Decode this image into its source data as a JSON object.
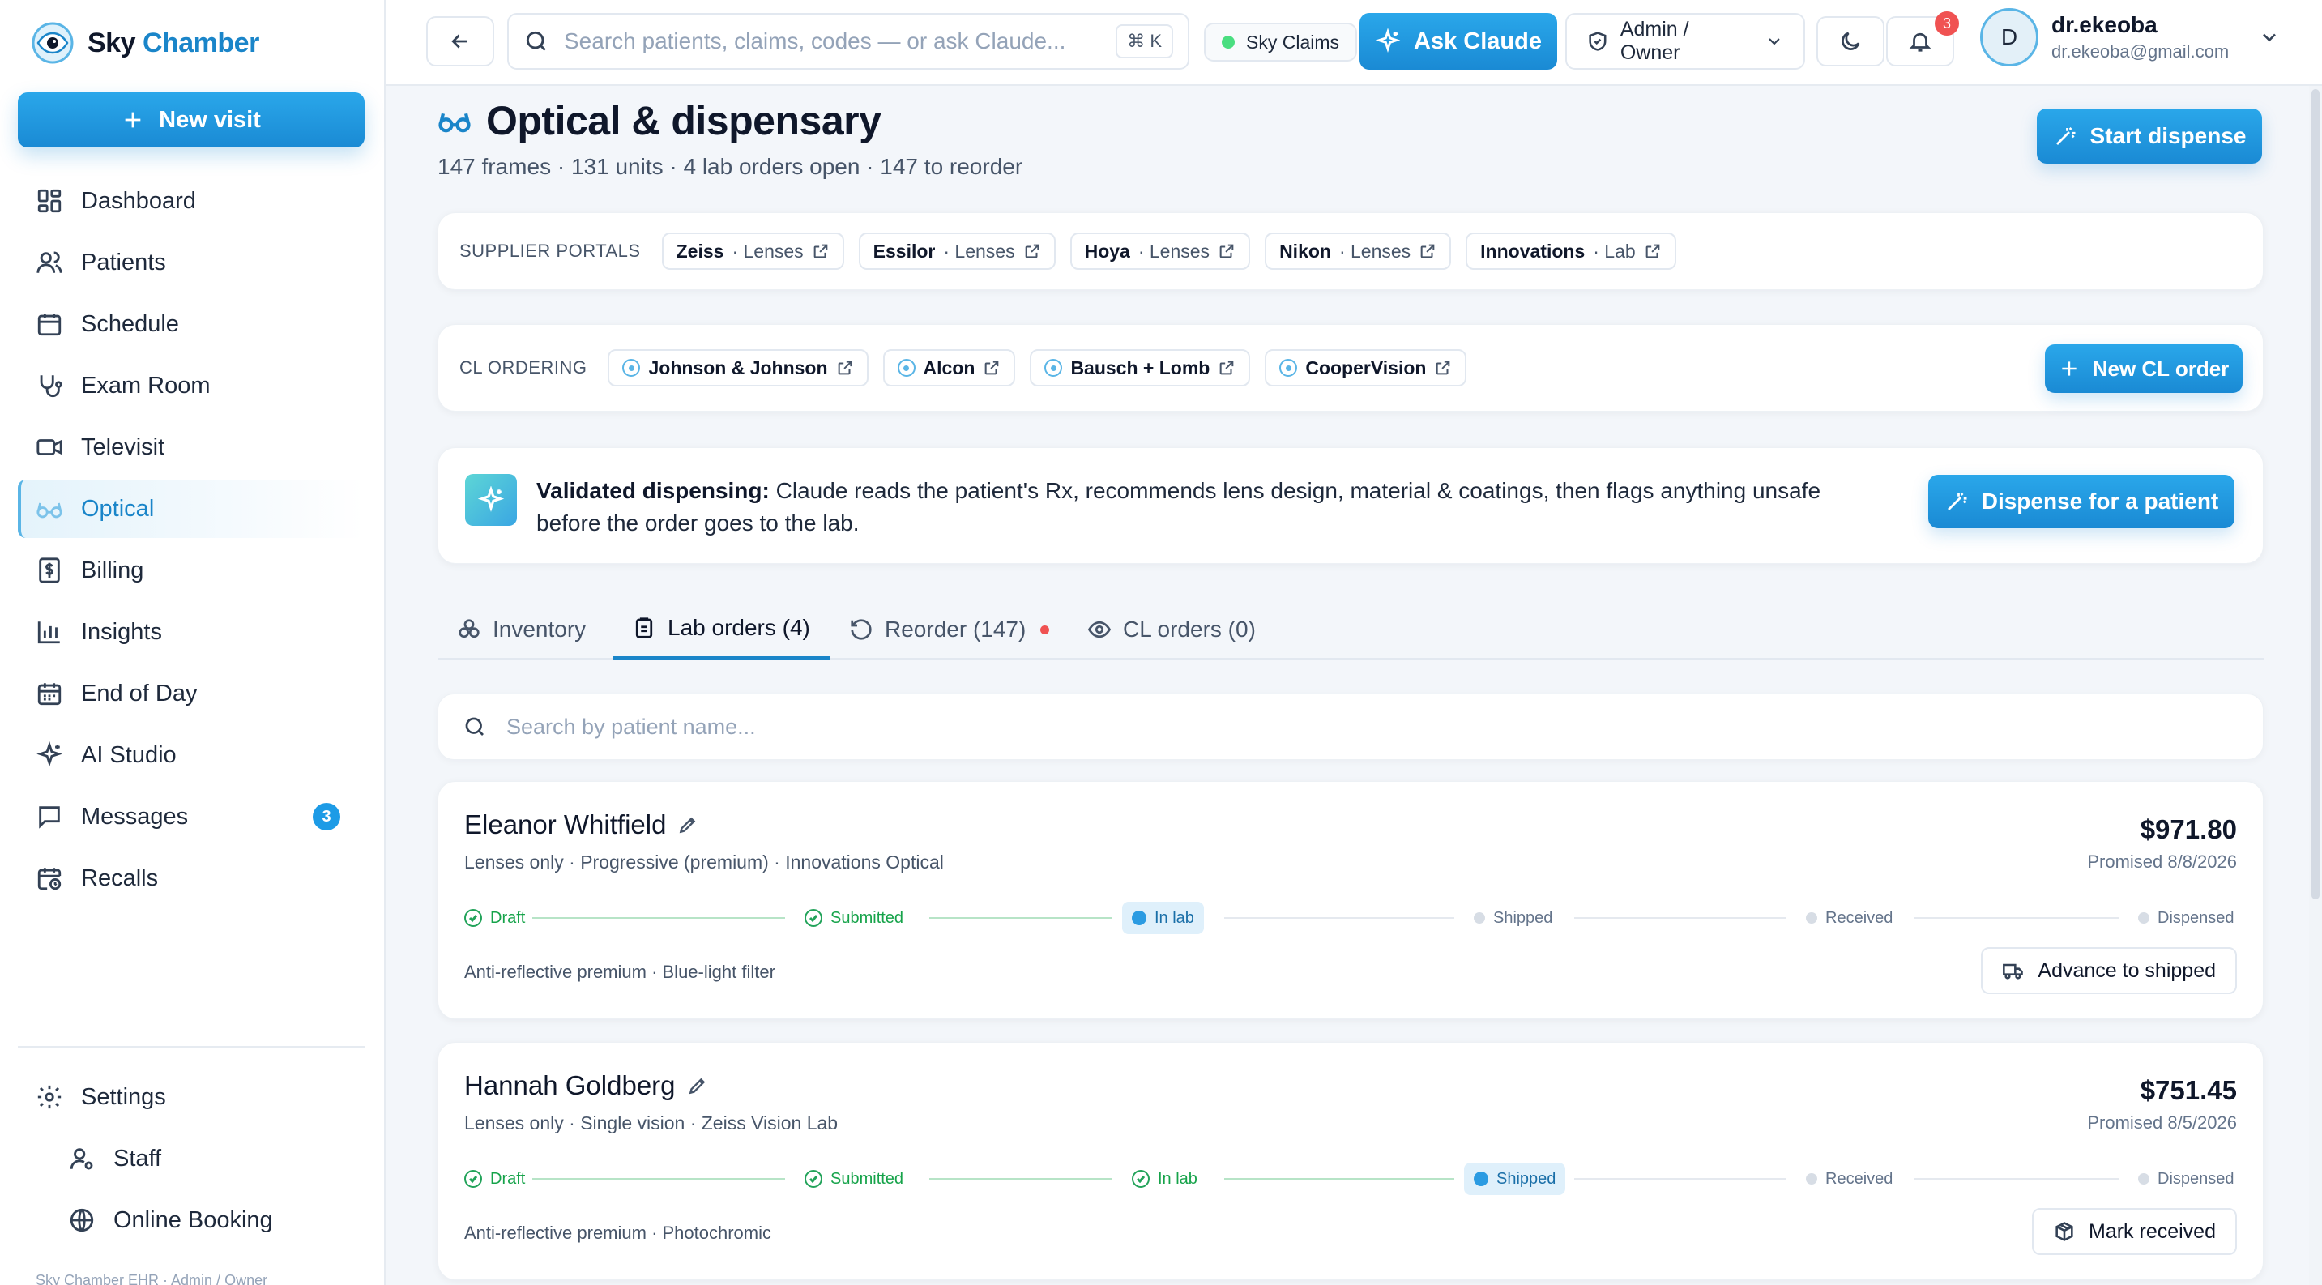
{
  "brand": {
    "name_main": "Sky",
    "name_accent": "Chamber"
  },
  "sidebar": {
    "new_visit": "New visit",
    "items": [
      {
        "label": "Dashboard",
        "icon": "dashboard-icon"
      },
      {
        "label": "Patients",
        "icon": "users-icon"
      },
      {
        "label": "Schedule",
        "icon": "calendar-icon"
      },
      {
        "label": "Exam Room",
        "icon": "stethoscope-icon"
      },
      {
        "label": "Televisit",
        "icon": "video-icon"
      },
      {
        "label": "Optical",
        "icon": "glasses-icon"
      },
      {
        "label": "Billing",
        "icon": "dollar-icon"
      },
      {
        "label": "Insights",
        "icon": "bar-chart-icon"
      },
      {
        "label": "End of Day",
        "icon": "calendar-check-icon"
      },
      {
        "label": "AI Studio",
        "icon": "sparkles-icon"
      },
      {
        "label": "Messages",
        "icon": "message-icon",
        "badge": "3"
      },
      {
        "label": "Recalls",
        "icon": "calendar-clock-icon"
      }
    ],
    "bottom_items": [
      {
        "label": "Settings",
        "icon": "gear-icon"
      },
      {
        "label": "Staff",
        "icon": "user-cog-icon"
      },
      {
        "label": "Online Booking",
        "icon": "globe-icon"
      }
    ],
    "footer": "Sky Chamber EHR · Admin / Owner"
  },
  "topbar": {
    "search_placeholder": "Search patients, claims, codes — or ask Claude...",
    "shortcut": "⌘ K",
    "status": "Sky Claims",
    "ask_claude": "Ask Claude",
    "role": "Admin / Owner",
    "notifications": "3",
    "user": {
      "initial": "D",
      "name": "dr.ekeoba",
      "email": "dr.ekeoba@gmail.com"
    }
  },
  "page": {
    "title": "Optical & dispensary",
    "subtitle": "147 frames · 131 units · 4 lab orders open · 147 to reorder",
    "start_dispense": "Start dispense"
  },
  "supplier_portals": {
    "label": "SUPPLIER PORTALS",
    "items": [
      {
        "name": "Zeiss",
        "type": "· Lenses"
      },
      {
        "name": "Essilor",
        "type": "· Lenses"
      },
      {
        "name": "Hoya",
        "type": "· Lenses"
      },
      {
        "name": "Nikon",
        "type": "· Lenses"
      },
      {
        "name": "Innovations",
        "type": "· Lab"
      }
    ]
  },
  "cl_ordering": {
    "label": "CL ORDERING",
    "items": [
      "Johnson & Johnson",
      "Alcon",
      "Bausch + Lomb",
      "CooperVision"
    ],
    "new_order": "New CL order"
  },
  "validated": {
    "bold": "Validated dispensing:",
    "text": " Claude reads the patient's Rx, recommends lens design, material & coatings, then flags anything unsafe before the order goes to the lab.",
    "button": "Dispense for a patient"
  },
  "tabs": [
    {
      "label": "Inventory",
      "icon": "boxes-icon"
    },
    {
      "label": "Lab orders (4)",
      "icon": "clipboard-icon"
    },
    {
      "label": "Reorder (147)",
      "icon": "refresh-icon"
    },
    {
      "label": "CL orders (0)",
      "icon": "eye-icon"
    }
  ],
  "patient_search_placeholder": "Search by patient name...",
  "orders": [
    {
      "name": "Eleanor Whitfield",
      "desc": "Lenses only · Progressive (premium) · Innovations Optical",
      "price": "$971.80",
      "promised": "Promised 8/8/2026",
      "steps": [
        "Draft",
        "Submitted",
        "In lab",
        "Shipped",
        "Received",
        "Dispensed"
      ],
      "current": 2,
      "coatings": "Anti-reflective premium · Blue-light filter",
      "action": "Advance to shipped"
    },
    {
      "name": "Hannah Goldberg",
      "desc": "Lenses only · Single vision · Zeiss Vision Lab",
      "price": "$751.45",
      "promised": "Promised 8/5/2026",
      "steps": [
        "Draft",
        "Submitted",
        "In lab",
        "Shipped",
        "Received",
        "Dispensed"
      ],
      "current": 3,
      "coatings": "Anti-reflective premium · Photochromic",
      "action": "Mark received"
    }
  ]
}
